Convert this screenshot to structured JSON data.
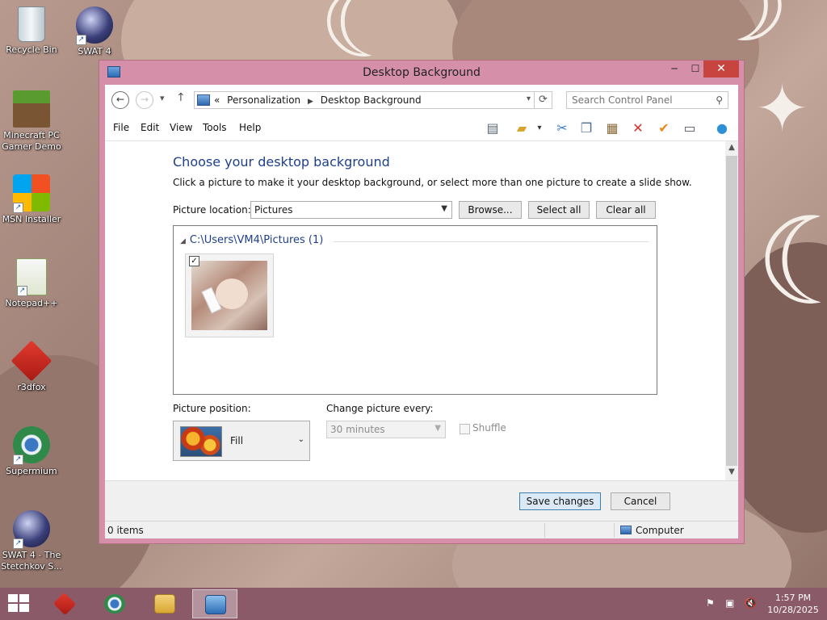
{
  "desktop": {
    "icons": [
      {
        "label": "Recycle Bin",
        "icon": "recycle-bin-icon"
      },
      {
        "label": "SWAT 4",
        "icon": "swat4-icon"
      },
      {
        "label": "Minecraft PC Gamer Demo",
        "icon": "minecraft-icon"
      },
      {
        "label": "MSN Installer",
        "icon": "msn-icon"
      },
      {
        "label": "Notepad++",
        "icon": "notepadpp-icon"
      },
      {
        "label": "r3dfox",
        "icon": "r3dfox-icon"
      },
      {
        "label": "Supermium",
        "icon": "supermium-icon"
      },
      {
        "label": "SWAT 4 - The Stetchkov S...",
        "icon": "swat4-stetchkov-icon"
      }
    ]
  },
  "window": {
    "title": "Desktop Background",
    "controls": {
      "minimize": "─",
      "maximize": "☐",
      "close": "✕"
    },
    "address": {
      "overflow": "«",
      "crumbs": [
        "Personalization",
        "Desktop Background"
      ]
    },
    "search": {
      "placeholder": "Search Control Panel"
    },
    "menu": [
      "File",
      "Edit",
      "View",
      "Tools",
      "Help"
    ],
    "toolbar": [
      "layout-icon",
      "folder-options-icon",
      "cut-icon",
      "copy-icon",
      "paste-icon",
      "delete-icon",
      "properties-check-icon",
      "rename-icon",
      "help-globe-icon"
    ]
  },
  "content": {
    "heading": "Choose your desktop background",
    "instructions": "Click a picture to make it your desktop background, or select more than one picture to create a slide show.",
    "location_label": "Picture location:",
    "location_value": "Pictures",
    "browse": "Browse...",
    "select_all": "Select all",
    "clear_all": "Clear all",
    "group_header": "C:\\Users\\VM4\\Pictures (1)",
    "thumbnail": {
      "checked": true,
      "check_glyph": "✓"
    },
    "position_label": "Picture position:",
    "position_value": "Fill",
    "interval_label": "Change picture every:",
    "interval_value": "30 minutes",
    "shuffle_label": "Shuffle",
    "shuffle_checked": false
  },
  "footer": {
    "save": "Save changes",
    "cancel": "Cancel"
  },
  "status": {
    "items": "0 items",
    "location": "Computer"
  },
  "taskbar": {
    "apps": [
      "r3dfox-icon",
      "supermium-icon",
      "file-explorer-icon",
      "control-panel-icon"
    ],
    "active_app": "control-panel-icon",
    "time": "1:57 PM",
    "date": "10/28/2025"
  },
  "colors": {
    "accent": "#1e3f8a",
    "window_frame": "#d68fa8",
    "close_button": "#c7443f",
    "taskbar": "#8b5a69"
  }
}
